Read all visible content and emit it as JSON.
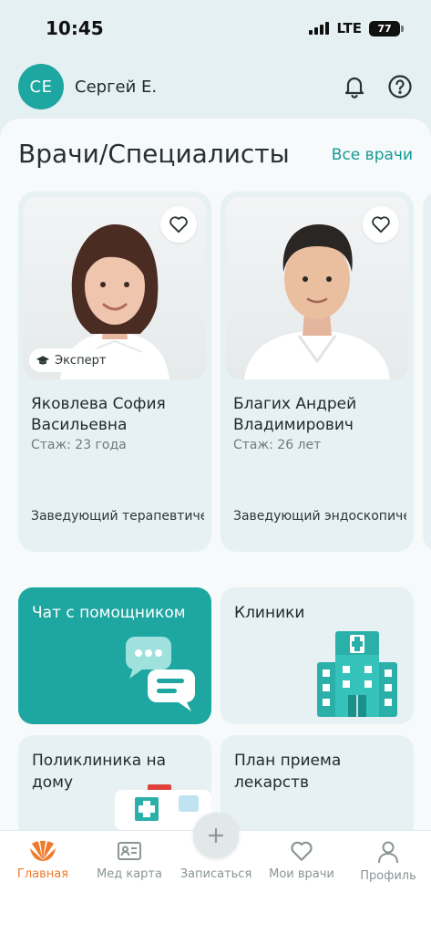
{
  "status_bar": {
    "time": "10:45",
    "network": "LTE",
    "battery": "77"
  },
  "header": {
    "avatar_initials": "СЕ",
    "user_name": "Сергей Е."
  },
  "doctors_section": {
    "title": "Врачи/Специалисты",
    "all_link": "Все врачи",
    "cards": [
      {
        "name": "Яковлева София Васильевна",
        "experience": "Стаж: 23 года",
        "position": "Заведующий терапевтическим отде...",
        "badge": "Эксперт"
      },
      {
        "name": "Благих Андрей Владимирович",
        "experience": "Стаж: 26 лет",
        "position": "Заведующий эндоскопическим отд..."
      }
    ]
  },
  "tiles": {
    "chat": "Чат с помощником",
    "clinics": "Клиники",
    "home": "Поликлиника на дому",
    "meds": "План приема лекарств"
  },
  "bottom_nav": {
    "home": "Главная",
    "medcard": "Мед карта",
    "book": "Записаться",
    "my_doctors": "Мои врачи",
    "profile": "Профиль"
  },
  "colors": {
    "accent": "#1ea6a1",
    "active_nav": "#f07a2e",
    "background": "#e4f0f1"
  }
}
